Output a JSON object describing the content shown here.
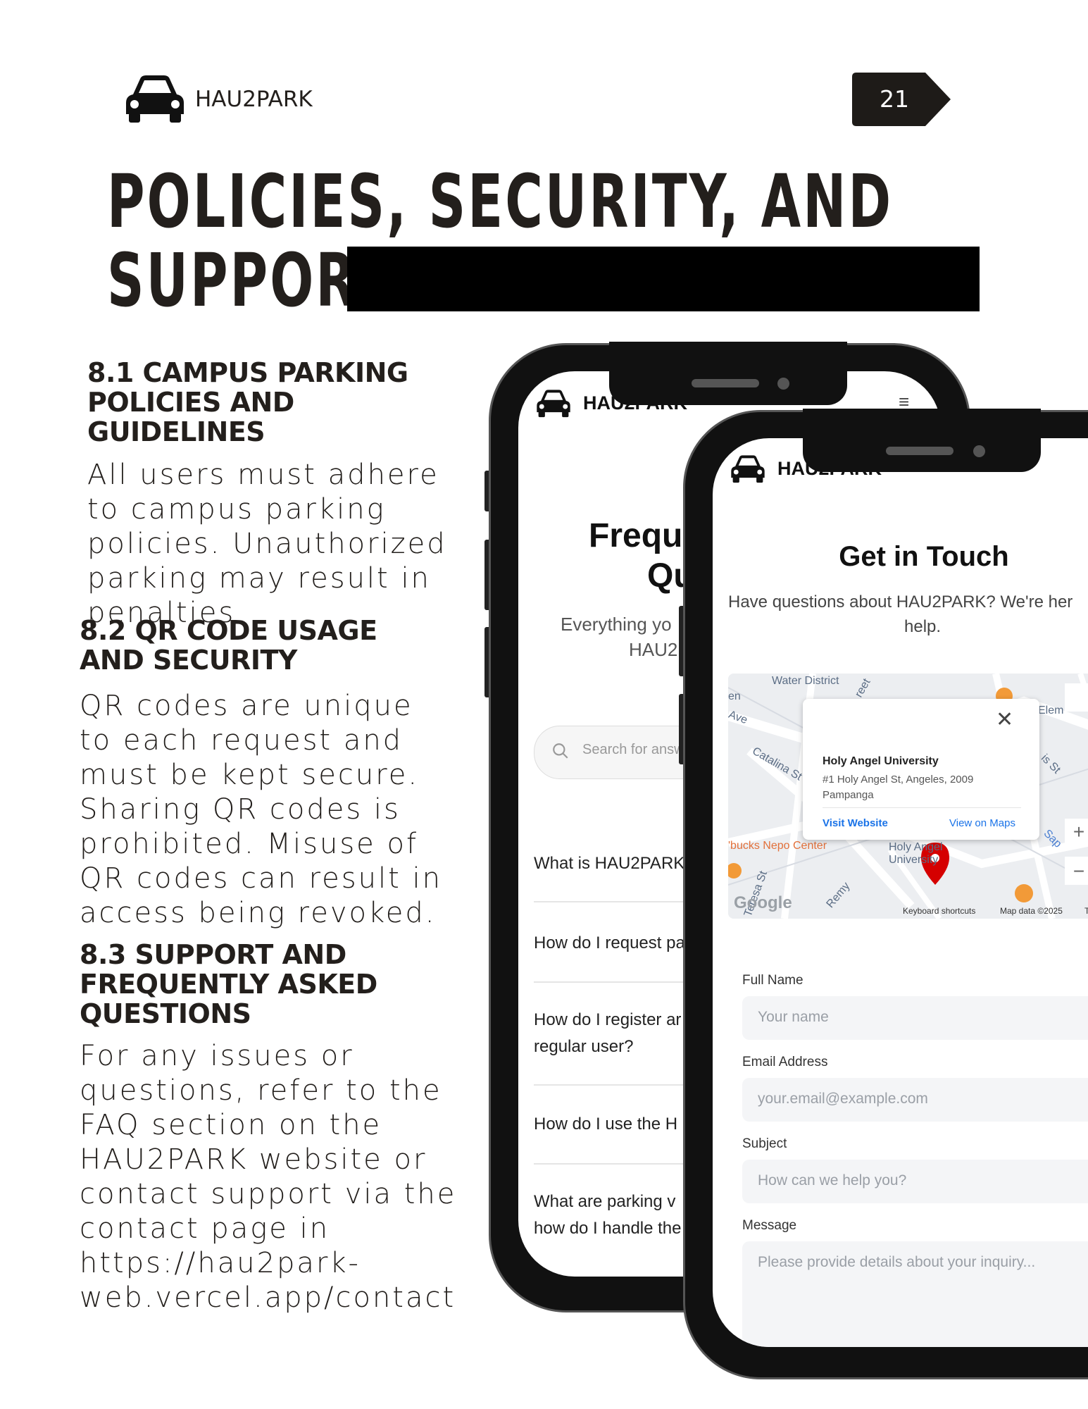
{
  "header": {
    "brand": "HAU2PARK",
    "page_number": "21"
  },
  "title": {
    "line1": "POLICIES, SECURITY, AND",
    "line2": "SUPPORT"
  },
  "sections": [
    {
      "heading": "8.1 CAMPUS PARKING POLICIES AND GUIDELINES",
      "body": "All users must adhere to campus parking policies. Unauthorized parking may result in penalties."
    },
    {
      "heading": "8.2 QR CODE USAGE AND SECURITY",
      "body": "QR codes are unique to each request and must be kept secure. Sharing QR codes is prohibited. Misuse of QR codes can result in access being revoked."
    },
    {
      "heading": "8.3 SUPPORT AND FREQUENTLY ASKED QUESTIONS",
      "body": "For any issues or questions, refer to the FAQ section on the HAU2PARK website or contact support via the contact page in https://hau2park-web.vercel.app/contact"
    }
  ],
  "phone_faq": {
    "brand": "HAU2PARK",
    "menu_icon": "≡",
    "title_line1": "Frequ",
    "title_line2": "Qu",
    "subtitle_line1": "Everything yo",
    "subtitle_line2": "HAU2",
    "search_placeholder": "Search for answ",
    "questions": [
      "What is HAU2PARK",
      "How do I request pa",
      "How do I register ar regular user?",
      "How do I use the H",
      "What are parking v how do I handle the"
    ]
  },
  "phone_contact": {
    "brand": "HAU2PARK",
    "title": "Get in Touch",
    "subtitle_line1": "Have questions about HAU2PARK? We're her",
    "subtitle_line2": "help.",
    "map": {
      "place_name": "Holy Angel University",
      "address": "#1 Holy Angel St, Angeles, 2009 Pampanga",
      "visit_website": "Visit Website",
      "view_on_maps": "View on Maps",
      "labels": {
        "water_district": "Water District",
        "catalina": "Catalina St",
        "buckets": "'bucks Nepo Center",
        "teresa": "Teresa St",
        "remy": "Remy",
        "holy_angel": "Holy Angel University",
        "elem": "Elem",
        "ave": "Ave",
        "en": "en",
        "sap": "Sap",
        "is_st": "is St",
        "reet": "reet"
      },
      "google": "Google",
      "keyboard_shortcuts": "Keyboard shortcuts",
      "map_data": "Map data ©2025",
      "terms": "T"
    },
    "form": {
      "full_name_label": "Full Name",
      "full_name_placeholder": "Your name",
      "email_label": "Email Address",
      "email_placeholder": "your.email@example.com",
      "subject_label": "Subject",
      "subject_placeholder": "How can we help you?",
      "message_label": "Message",
      "message_placeholder": "Please provide details about your inquiry..."
    }
  },
  "colors": {
    "ink": "#231f1c",
    "badge": "#1e1b18",
    "link_blue": "#1a73e8",
    "map_pin": "#d50000"
  }
}
